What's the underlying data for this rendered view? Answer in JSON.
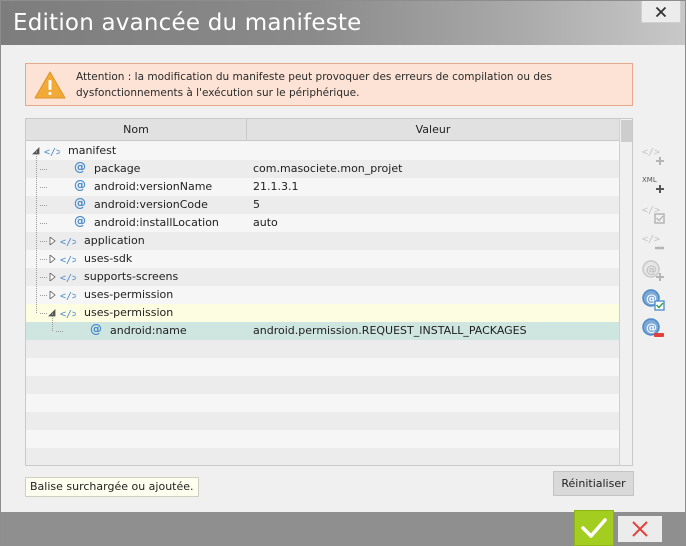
{
  "window": {
    "title": "Edition avancée du manifeste"
  },
  "warning": {
    "text": "Attention : la modification du manifeste peut provoquer des erreurs de compilation ou des dysfonctionnements à l'exécution sur le périphérique."
  },
  "grid": {
    "columns": [
      "Nom",
      "Valeur"
    ],
    "rows": [
      {
        "name": "manifest",
        "value": "",
        "kind": "tag",
        "level": 0,
        "expander": "expanded"
      },
      {
        "name": "package",
        "value": "com.masociete.mon_projet",
        "kind": "attribute",
        "level": 1
      },
      {
        "name": "android:versionName",
        "value": "21.1.3.1",
        "kind": "attribute",
        "level": 1
      },
      {
        "name": "android:versionCode",
        "value": "5",
        "kind": "attribute",
        "level": 1
      },
      {
        "name": "android:installLocation",
        "value": "auto",
        "kind": "attribute",
        "level": 1
      },
      {
        "name": "application",
        "value": "",
        "kind": "tag",
        "level": 1,
        "expander": "collapsed"
      },
      {
        "name": "uses-sdk",
        "value": "",
        "kind": "tag",
        "level": 1,
        "expander": "collapsed"
      },
      {
        "name": "supports-screens",
        "value": "",
        "kind": "tag",
        "level": 1,
        "expander": "collapsed"
      },
      {
        "name": "uses-permission",
        "value": "",
        "kind": "tag",
        "level": 1,
        "expander": "collapsed"
      },
      {
        "name": "uses-permission",
        "value": "",
        "kind": "tag",
        "level": 1,
        "expander": "expanded",
        "state": "overridden"
      },
      {
        "name": "android:name",
        "value": "android.permission.REQUEST_INSTALL_PACKAGES",
        "kind": "attribute",
        "level": 2,
        "state": "selected"
      }
    ]
  },
  "toolbar": {
    "buttons": [
      {
        "name": "add-tag-icon",
        "enabled": false
      },
      {
        "name": "add-xml-icon",
        "enabled": true,
        "label": "XML"
      },
      {
        "name": "edit-tag-icon",
        "enabled": false
      },
      {
        "name": "remove-tag-icon",
        "enabled": false
      },
      {
        "name": "add-attribute-icon",
        "enabled": false
      },
      {
        "name": "edit-attribute-icon",
        "enabled": true
      },
      {
        "name": "remove-attribute-icon",
        "enabled": true
      }
    ]
  },
  "legend": {
    "text": "Balise surchargée ou ajoutée."
  },
  "actions": {
    "reset_label": "Réinitialiser",
    "ok_icon": "check-icon",
    "cancel_icon": "cross-icon"
  },
  "colors": {
    "title_bar": "#8a8a8a",
    "warning_bg": "#fde3d5",
    "overridden_row": "#fdfde1",
    "selected_row": "#cfe5df",
    "ok_green": "#a4ce1f",
    "cancel_red": "#e2403a",
    "icon_blue": "#4a8ac9"
  }
}
